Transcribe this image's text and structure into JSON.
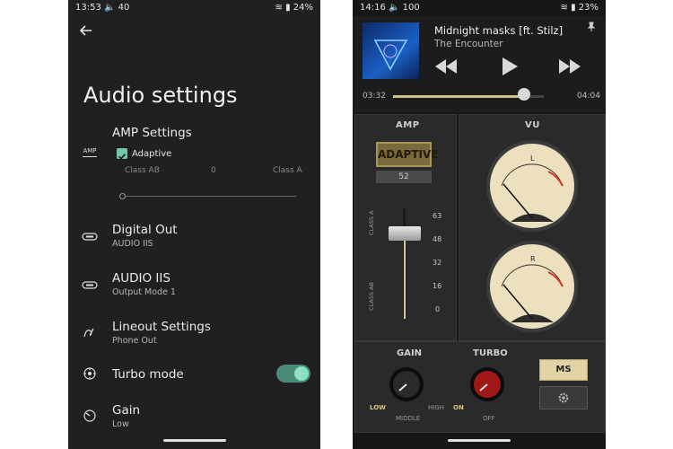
{
  "left_phone": {
    "status": {
      "time": "13:53",
      "left_extra": "40",
      "battery": "24%"
    },
    "title": "Audio settings",
    "amp": {
      "title": "AMP Settings",
      "icon_text": "AMP",
      "adaptive_label": "Adaptive",
      "adaptive_checked": true,
      "ticks": [
        "Class AB",
        "0",
        "Class A"
      ]
    },
    "rows": [
      {
        "title": "Digital Out",
        "subtitle": "AUDIO IIS",
        "icon": "digital-out-icon"
      },
      {
        "title": "AUDIO IIS",
        "subtitle": "Output Mode 1",
        "icon": "audio-iis-icon"
      },
      {
        "title": "Lineout Settings",
        "subtitle": "Phone Out",
        "icon": "lineout-icon"
      },
      {
        "title": "Turbo mode",
        "subtitle": "",
        "icon": "turbo-icon",
        "toggle_on": true
      },
      {
        "title": "Gain",
        "subtitle": "Low",
        "icon": "gain-icon"
      }
    ],
    "accent": "#74c7ad"
  },
  "right_phone": {
    "status": {
      "time": "14:16",
      "left_extra": "100",
      "battery": "23%"
    },
    "player": {
      "song": "Midnight masks [ft. Stilz]",
      "artist": "The Encounter",
      "elapsed": "03:32",
      "total": "04:04",
      "progress": 0.87
    },
    "amp": {
      "label": "AMP",
      "mode": "ADAPTIVE",
      "value": "52",
      "scale": [
        "63",
        "48",
        "32",
        "16",
        "0"
      ],
      "side_top": "CLASS A",
      "side_bottom": "CLASS AB"
    },
    "vu": {
      "label": "VU",
      "channels": [
        "L",
        "R"
      ],
      "ticks": [
        "20",
        "10",
        "7",
        "5",
        "3",
        "2",
        "1",
        "0",
        "1",
        "2",
        "3"
      ]
    },
    "gain": {
      "label": "GAIN",
      "low": "LOW",
      "middle": "MIDDLE",
      "high": "HIGH"
    },
    "turbo": {
      "label": "TURBO",
      "on": "ON",
      "off": "OFF"
    },
    "logo_text": "MS"
  }
}
